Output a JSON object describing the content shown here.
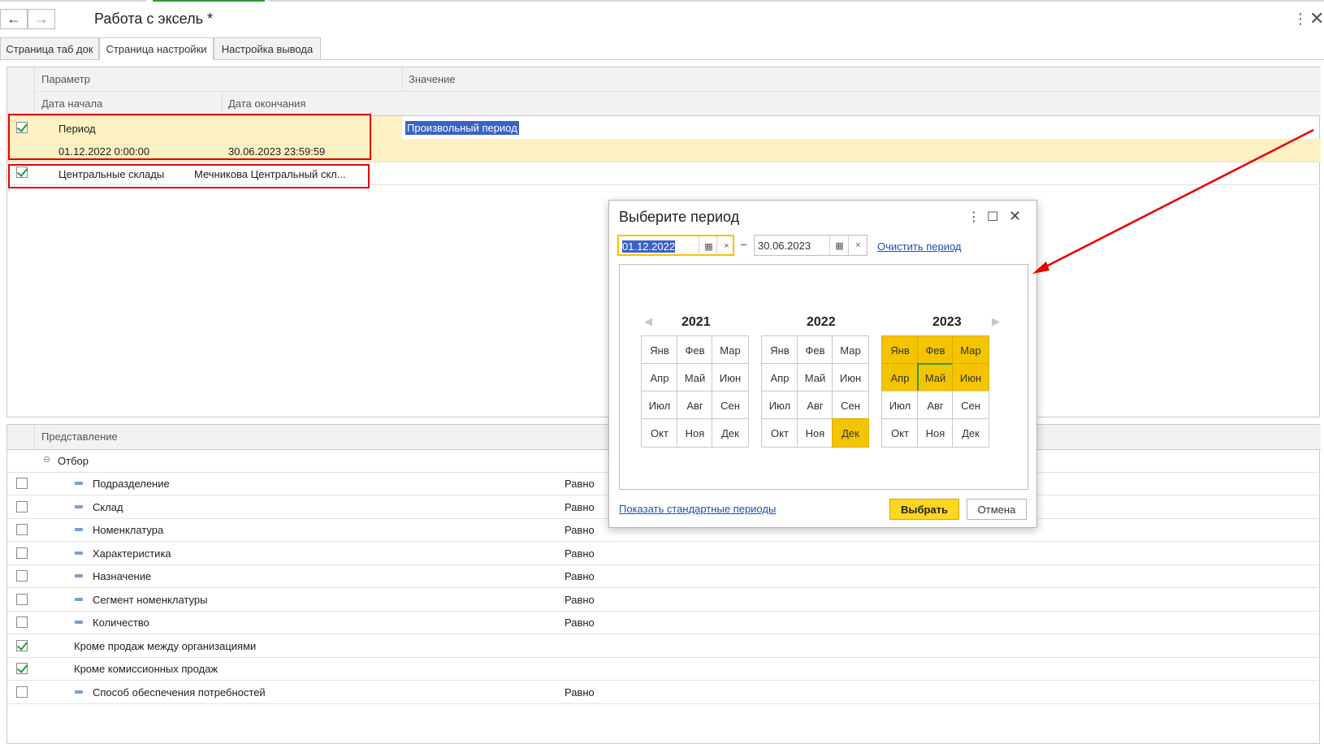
{
  "window": {
    "title": "Работа с эксель *",
    "back_icon": "←",
    "forward_icon": "→",
    "menu_icon": "⋮",
    "close_icon": "✕"
  },
  "tabs": [
    {
      "label": "Страница таб док"
    },
    {
      "label": "Страница настройки"
    },
    {
      "label": "Настройка вывода"
    }
  ],
  "settings_table": {
    "col_param": "Параметр",
    "col_value": "Значение",
    "col_start": "Дата начала",
    "col_end": "Дата окончания",
    "rows": [
      {
        "name": "Период",
        "checked": true,
        "value": "Произвольный период",
        "start": "01.12.2022 0:00:00",
        "end": "30.06.2023 23:59:59"
      },
      {
        "name": "Центральные склады",
        "checked": true,
        "value": "Мечникова Центральный скл..."
      }
    ]
  },
  "filter_table": {
    "col_repr": "Представление",
    "group": "Отбор",
    "rows": [
      {
        "label": "Подразделение",
        "cond": "Равно",
        "checked": false
      },
      {
        "label": "Склад",
        "cond": "Равно",
        "checked": false
      },
      {
        "label": "Номенклатура",
        "cond": "Равно",
        "checked": false
      },
      {
        "label": "Характеристика",
        "cond": "Равно",
        "checked": false
      },
      {
        "label": "Назначение",
        "cond": "Равно",
        "checked": false
      },
      {
        "label": "Сегмент номенклатуры",
        "cond": "Равно",
        "checked": false
      },
      {
        "label": "Количество",
        "cond": "Равно",
        "checked": false
      },
      {
        "label": "Кроме продаж между организациями",
        "cond": "",
        "checked": true
      },
      {
        "label": "Кроме комиссионных продаж",
        "cond": "",
        "checked": true
      },
      {
        "label": "Способ обеспечения потребностей",
        "cond": "Равно",
        "checked": false
      }
    ]
  },
  "dialog": {
    "title": "Выберите период",
    "date_from": "01.12.2022",
    "date_to": "30.06.2023",
    "dash": "–",
    "clear_link": "Очистить период",
    "show_standard_link": "Показать стандартные периоды",
    "ok_label": "Выбрать",
    "cancel_label": "Отмена",
    "calendar_icon": "▦",
    "clear_icon": "×",
    "prev_icon": "◀",
    "next_icon": "▶",
    "years": [
      "2021",
      "2022",
      "2023"
    ],
    "months": [
      "Янв",
      "Фев",
      "Мар",
      "Апр",
      "Май",
      "Июн",
      "Июл",
      "Авг",
      "Сен",
      "Окт",
      "Ноя",
      "Дек"
    ]
  }
}
